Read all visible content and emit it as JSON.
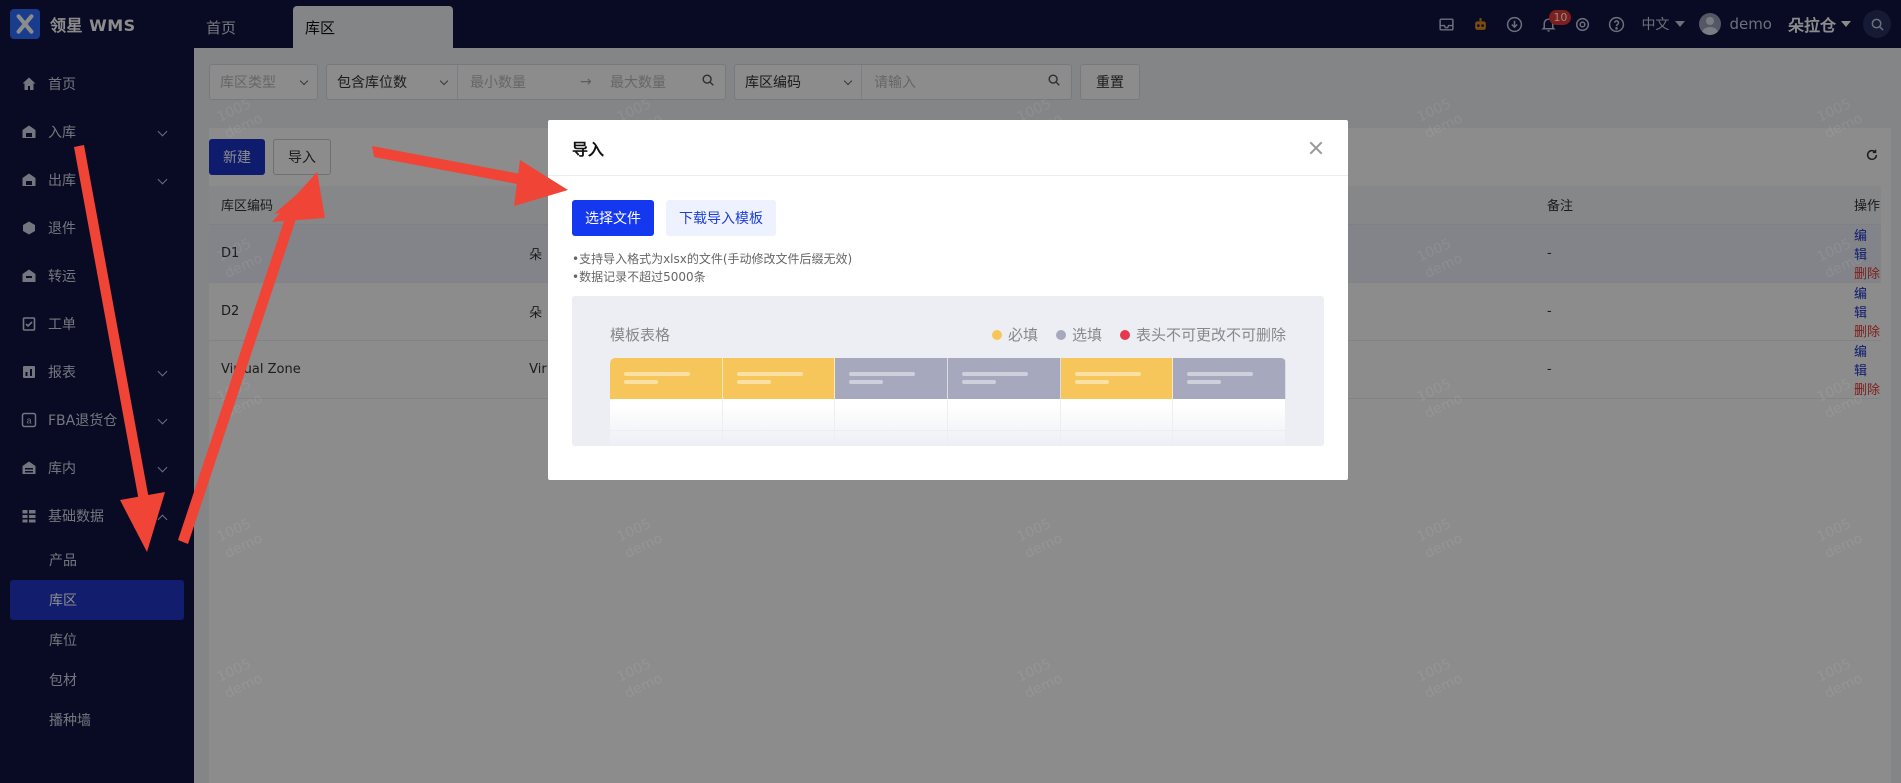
{
  "app": {
    "logo_text": "领星 WMS",
    "brand_color": "#0f1541",
    "accent_color": "#1c33c9"
  },
  "tabs": [
    {
      "label": "首页"
    },
    {
      "label": "库区"
    }
  ],
  "topbar": {
    "icons": [
      "inbox-icon",
      "robot-icon",
      "download-icon",
      "bell-icon",
      "settings-icon",
      "help-icon"
    ],
    "notification_count": "10",
    "language": "中文",
    "user": "demo",
    "warehouse": "朵拉仓"
  },
  "sidebar": {
    "items": [
      {
        "label": "首页",
        "icon": "home-icon",
        "expandable": false
      },
      {
        "label": "入库",
        "icon": "inbound-icon",
        "expandable": true
      },
      {
        "label": "出库",
        "icon": "outbound-icon",
        "expandable": true
      },
      {
        "label": "退件",
        "icon": "return-icon",
        "expandable": false
      },
      {
        "label": "转运",
        "icon": "transfer-icon",
        "expandable": false
      },
      {
        "label": "工单",
        "icon": "workorder-icon",
        "expandable": false
      },
      {
        "label": "报表",
        "icon": "report-icon",
        "expandable": true
      },
      {
        "label": "FBA退货仓",
        "icon": "fba-icon",
        "expandable": true
      },
      {
        "label": "库内",
        "icon": "warehouse-icon",
        "expandable": true
      },
      {
        "label": "基础数据",
        "icon": "grid-icon",
        "expandable": true,
        "expanded": true
      }
    ],
    "sub_items": [
      {
        "label": "产品"
      },
      {
        "label": "库区",
        "active": true
      },
      {
        "label": "库位"
      },
      {
        "label": "包材"
      },
      {
        "label": "播种墙"
      }
    ]
  },
  "filters": {
    "zone_type_placeholder": "库区类型",
    "contains_bins": "包含库位数",
    "min_qty_placeholder": "最小数量",
    "max_qty_placeholder": "最大数量",
    "zone_code": "库区编码",
    "input_placeholder": "请输入",
    "reset_label": "重置"
  },
  "toolbar": {
    "new_label": "新建",
    "import_label": "导入"
  },
  "table": {
    "headers": {
      "code": "库区编码",
      "remark": "备注",
      "action": "操作"
    },
    "rows": [
      {
        "code": "D1",
        "name": "朵",
        "remark": "-",
        "edit": "编辑",
        "delete": "删除"
      },
      {
        "code": "D2",
        "name": "朵",
        "remark": "-",
        "edit": "编辑",
        "delete": "删除"
      },
      {
        "code": "Virtual Zone",
        "name": "Vir",
        "remark": "-",
        "edit": "编辑",
        "delete": "删除"
      }
    ]
  },
  "modal": {
    "title": "导入",
    "choose_file": "选择文件",
    "download_template": "下载导入模板",
    "tip1": "•支持导入格式为xlsx的文件(手动修改文件后缀无效)",
    "tip2": "•数据记录不超过5000条",
    "template_title": "模板表格",
    "legend": [
      {
        "label": "必填",
        "color": "#f7c65a"
      },
      {
        "label": "选填",
        "color": "#a6a9be"
      },
      {
        "label": "表头不可更改不可删除",
        "color": "#e53950"
      }
    ],
    "column_colors": [
      "#f7c65a",
      "#f7c65a",
      "#a6a9be",
      "#a6a9be",
      "#f7c65a",
      "#a6a9be"
    ]
  },
  "watermark": {
    "line1": "1005",
    "line2": "demo"
  }
}
